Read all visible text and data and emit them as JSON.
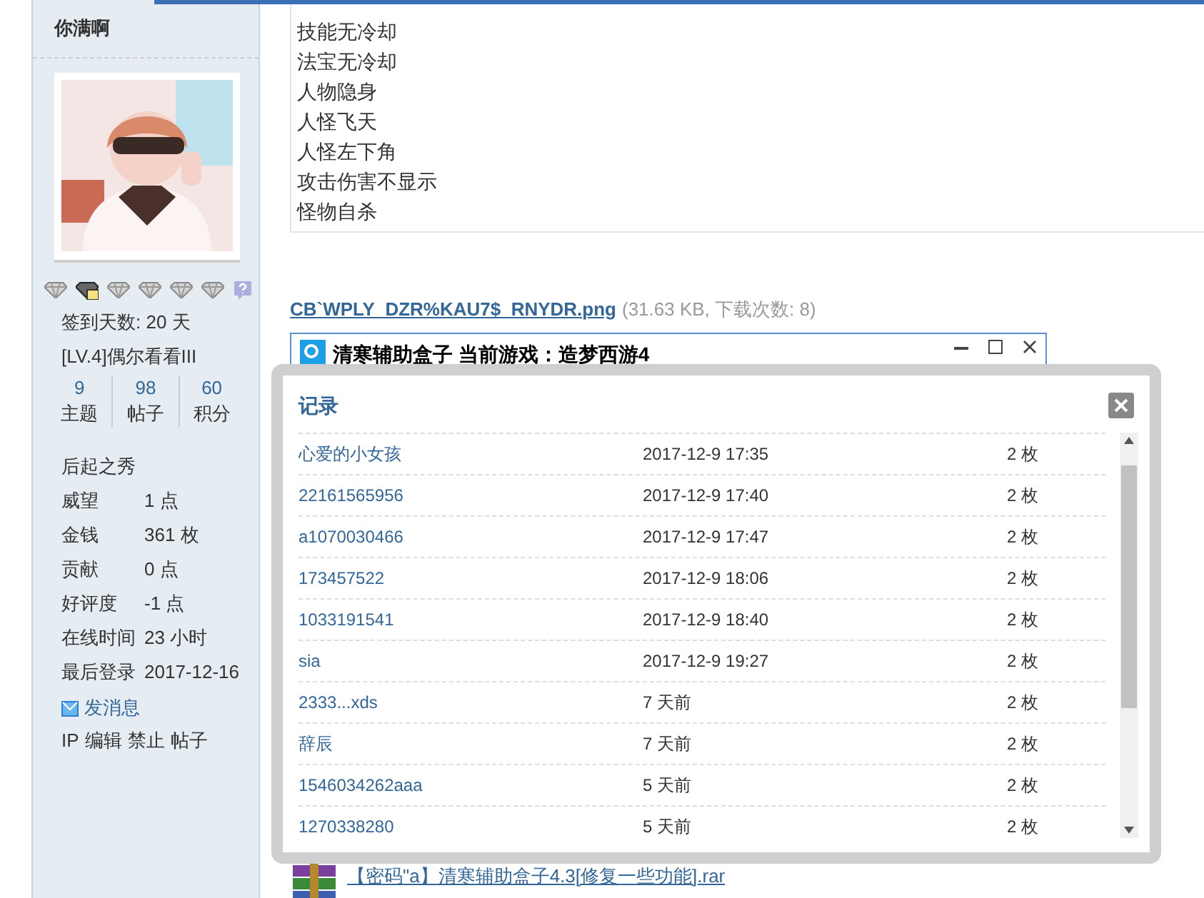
{
  "sidebar": {
    "username": "你满啊",
    "medals": [
      {
        "kind": "gem"
      },
      {
        "kind": "gem-card"
      },
      {
        "kind": "gem"
      },
      {
        "kind": "gem"
      },
      {
        "kind": "gem"
      },
      {
        "kind": "gem"
      },
      {
        "kind": "help"
      }
    ],
    "checkin": "签到天数: 20 天",
    "level": "[LV.4]偶尔看看III",
    "stats": [
      {
        "value": "9",
        "label": "主题"
      },
      {
        "value": "98",
        "label": "帖子"
      },
      {
        "value": "60",
        "label": "积分"
      }
    ],
    "rank": "后起之秀",
    "fields": [
      {
        "label": "威望",
        "value": "1 点"
      },
      {
        "label": "金钱",
        "value": "361 枚"
      },
      {
        "label": "贡献",
        "value": "0 点"
      },
      {
        "label": "好评度",
        "value": "-1 点"
      },
      {
        "label": "在线时间",
        "value": "23 小时"
      },
      {
        "label": "最后登录",
        "value": "2017-12-16"
      }
    ],
    "send_message": "发消息",
    "admin_links": [
      "IP",
      "编辑",
      "禁止",
      "帖子"
    ]
  },
  "post": {
    "lines": [
      "技能无冷却",
      "法宝无冷却",
      "人物隐身",
      "人怪飞天",
      "人怪左下角",
      "攻击伤害不显示",
      "怪物自杀"
    ],
    "attachment": {
      "name": "CB`WPLY_DZR%KAU7$_RNYDR.png",
      "info": "(31.63 KB, 下载次数: 8)"
    },
    "app_window": {
      "title": "清寒辅助盒子 当前游戏：造梦西游4"
    },
    "rar": {
      "name": "【密码\"a】清寒辅助盒子4.3[修复一些功能].rar"
    }
  },
  "dialog": {
    "title": "记录",
    "rows": [
      {
        "name": "心爱的小女孩",
        "time": "2017-12-9 17:35",
        "amount": "2 枚"
      },
      {
        "name": "22161565956",
        "time": "2017-12-9 17:40",
        "amount": "2 枚"
      },
      {
        "name": "a1070030466",
        "time": "2017-12-9 17:47",
        "amount": "2 枚"
      },
      {
        "name": "173457522",
        "time": "2017-12-9 18:06",
        "amount": "2 枚"
      },
      {
        "name": "1033191541",
        "time": "2017-12-9 18:40",
        "amount": "2 枚"
      },
      {
        "name": "sia",
        "time": "2017-12-9 19:27",
        "amount": "2 枚"
      },
      {
        "name": "2333...xds",
        "time": "7 天前",
        "amount": "2 枚"
      },
      {
        "name": "辞辰",
        "time": "7 天前",
        "amount": "2 枚"
      },
      {
        "name": "1546034262aaa",
        "time": "5 天前",
        "amount": "2 枚"
      },
      {
        "name": "1270338280",
        "time": "5 天前",
        "amount": "2 枚"
      }
    ]
  }
}
